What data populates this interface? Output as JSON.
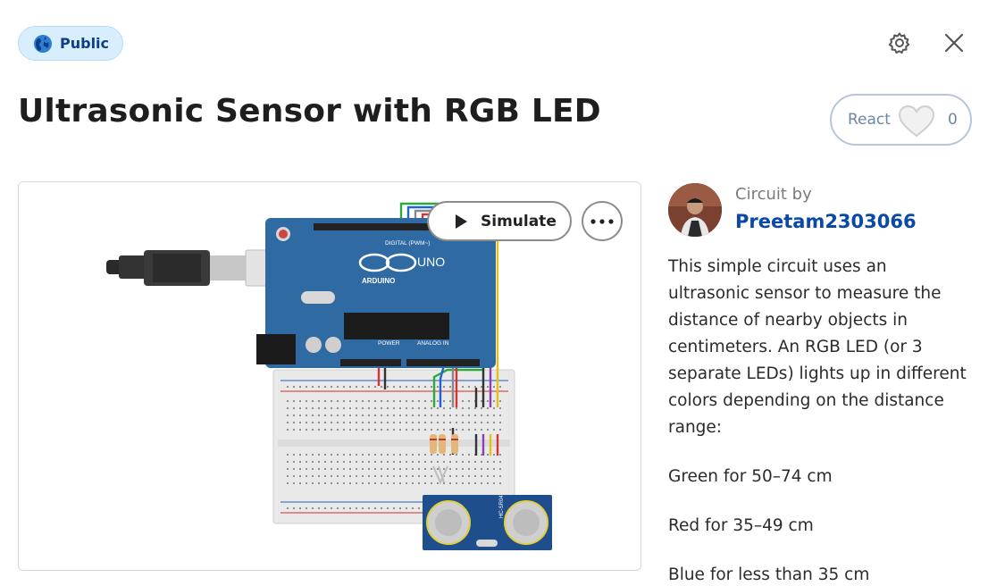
{
  "visibility": {
    "label": "Public",
    "icon": "globe-icon"
  },
  "header": {
    "settings_icon": "gear-icon",
    "close_icon": "close-icon"
  },
  "project": {
    "title": "Ultrasonic Sensor with RGB LED"
  },
  "react": {
    "label": "React",
    "count": "0",
    "icon": "heart-icon"
  },
  "viewer": {
    "simulate_label": "Simulate",
    "more_icon": "more-icon"
  },
  "circuit_labels": {
    "board_brand": "ARDUINO",
    "board_model": "UNO",
    "digital_header": "DIGITAL (PWM~)",
    "power_header": "POWER",
    "analog_header": "ANALOG IN",
    "sensor_model": "HC-SR04"
  },
  "author": {
    "caption": "Circuit by",
    "name": "Preetam2303066"
  },
  "description": {
    "intro": "This simple circuit uses an ultrasonic sensor to measure the distance of nearby objects in centimeters. An RGB LED (or 3 separate LEDs) lights up in different colors depending on the distance range:",
    "items": [
      "Green for 50–74 cm",
      "Red for 35–49 cm",
      "Blue for less than 35 cm"
    ]
  },
  "colors": {
    "badge_bg": "#d9eefc",
    "badge_text": "#0b3f8a",
    "link": "#0a49a6",
    "arduino_blue": "#2f6aa3",
    "sensor_blue": "#1f4e8c"
  }
}
